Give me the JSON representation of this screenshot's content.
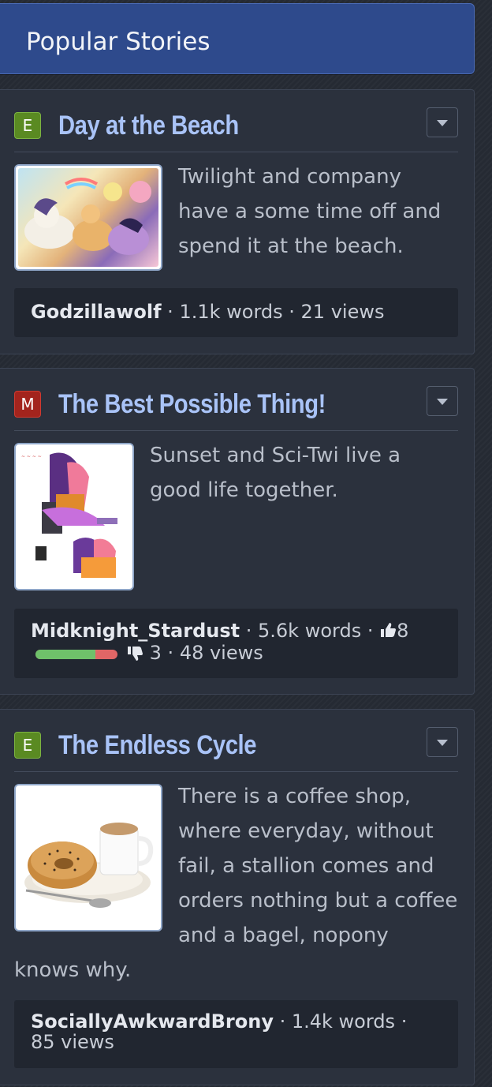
{
  "header": {
    "title": "Popular Stories"
  },
  "stories": [
    {
      "rating": "E",
      "title": "Day at the Beach",
      "description": "Twilight and company have a some time off and spend it at the beach.",
      "author": "Godzillawolf",
      "words": "1.1k words",
      "views": "21 views"
    },
    {
      "rating": "M",
      "title": "The Best Possible Thing!",
      "description": "Sunset and Sci-Twi live a good life together.",
      "author": "Midknight_Stardust",
      "words": "5.6k words",
      "likes": "8",
      "dislikes": "3",
      "like_fraction": 0.73,
      "views": "48 views"
    },
    {
      "rating": "E",
      "title": "The Endless Cycle",
      "description": "There is a coffee shop, where everyday, without fail, a stallion comes and orders nothing but a coffee and a bagel, nopony knows why.",
      "author": "SociallyAwkwardBrony",
      "words": "1.4k words",
      "views": "85 views"
    }
  ],
  "separator": " · ",
  "icons": {
    "like": "thumbs-up-icon",
    "dislike": "thumbs-down-icon",
    "dropdown": "chevron-down-icon"
  },
  "colors": {
    "header": "#2e4a8c",
    "title": "#a9c3f7",
    "rating_e": "#5a8a22",
    "rating_m": "#a3241d",
    "like": "#6fc16a",
    "dislike": "#e06666"
  }
}
